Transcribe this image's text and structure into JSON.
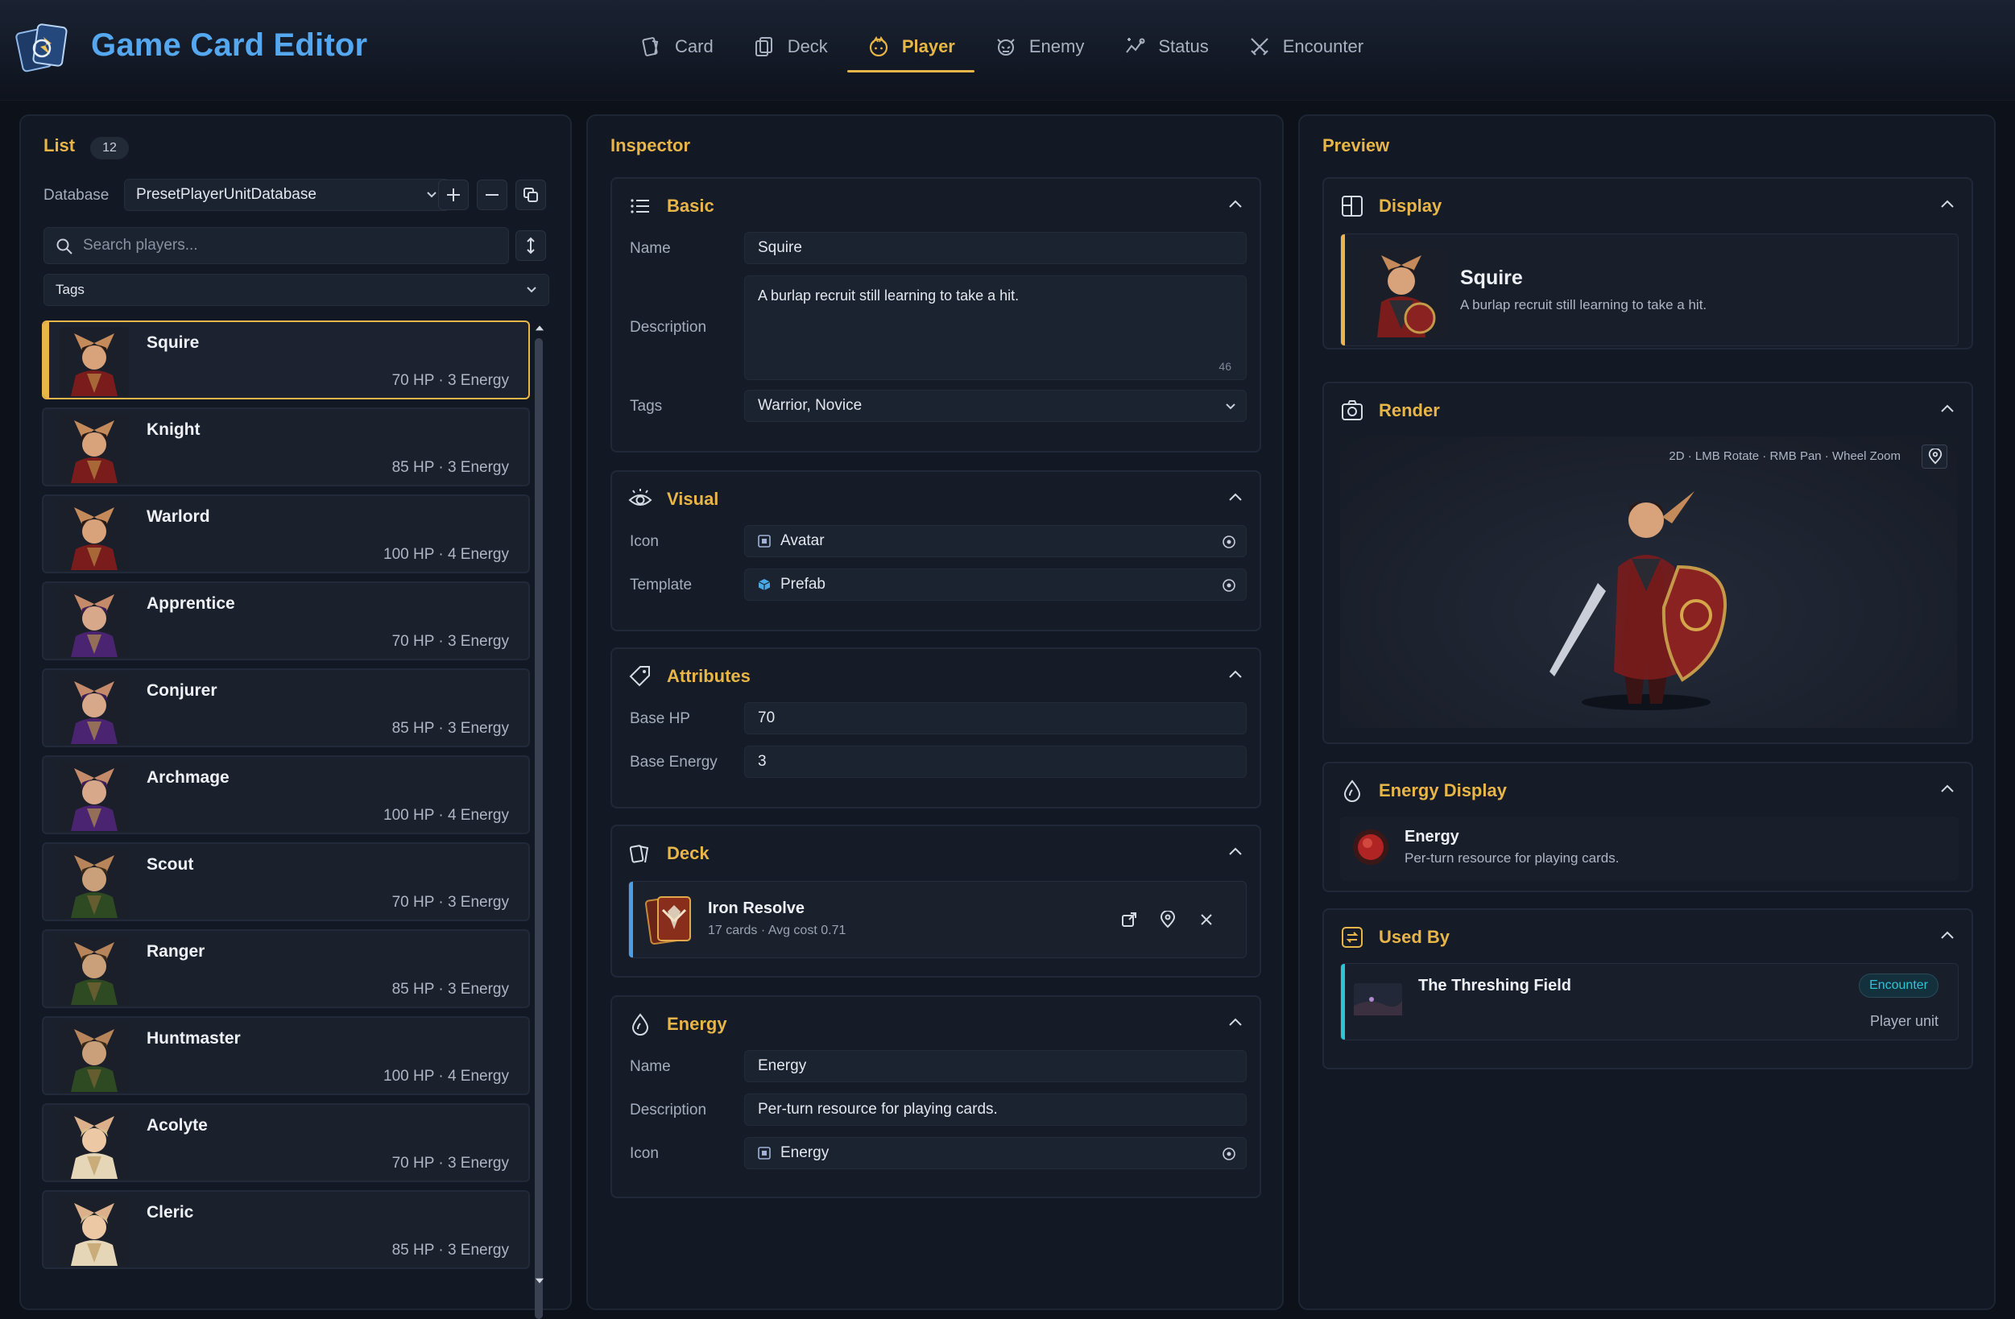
{
  "app": {
    "title": "Game Card Editor"
  },
  "nav": {
    "tabs": [
      {
        "label": "Card",
        "icon": "card-icon",
        "active": false
      },
      {
        "label": "Deck",
        "icon": "deck-icon",
        "active": false
      },
      {
        "label": "Player",
        "icon": "player-icon",
        "active": true
      },
      {
        "label": "Enemy",
        "icon": "enemy-icon",
        "active": false
      },
      {
        "label": "Status",
        "icon": "status-icon",
        "active": false
      },
      {
        "label": "Encounter",
        "icon": "encounter-icon",
        "active": false
      }
    ]
  },
  "list": {
    "title": "List",
    "count": "12",
    "database_label": "Database",
    "database_value": "PresetPlayerUnitDatabase",
    "search_placeholder": "Search players...",
    "tags_label": "Tags",
    "players": [
      {
        "name": "Squire",
        "stats": "70 HP · 3 Energy",
        "selected": true,
        "theme": "warrior"
      },
      {
        "name": "Knight",
        "stats": "85 HP · 3 Energy",
        "selected": false,
        "theme": "warrior"
      },
      {
        "name": "Warlord",
        "stats": "100 HP · 4 Energy",
        "selected": false,
        "theme": "warrior"
      },
      {
        "name": "Apprentice",
        "stats": "70 HP · 3 Energy",
        "selected": false,
        "theme": "mage"
      },
      {
        "name": "Conjurer",
        "stats": "85 HP · 3 Energy",
        "selected": false,
        "theme": "mage"
      },
      {
        "name": "Archmage",
        "stats": "100 HP · 4 Energy",
        "selected": false,
        "theme": "mage"
      },
      {
        "name": "Scout",
        "stats": "70 HP · 3 Energy",
        "selected": false,
        "theme": "ranger"
      },
      {
        "name": "Ranger",
        "stats": "85 HP · 3 Energy",
        "selected": false,
        "theme": "ranger"
      },
      {
        "name": "Huntmaster",
        "stats": "100 HP · 4 Energy",
        "selected": false,
        "theme": "ranger"
      },
      {
        "name": "Acolyte",
        "stats": "70 HP · 3 Energy",
        "selected": false,
        "theme": "cleric"
      },
      {
        "name": "Cleric",
        "stats": "85 HP · 3 Energy",
        "selected": false,
        "theme": "cleric"
      }
    ]
  },
  "inspector": {
    "title": "Inspector",
    "basic": {
      "title": "Basic",
      "name_label": "Name",
      "name_value": "Squire",
      "description_label": "Description",
      "description_value": "A burlap recruit still learning to take a hit.",
      "char_count": "46",
      "tags_label": "Tags",
      "tags_value": "Warrior, Novice"
    },
    "visual": {
      "title": "Visual",
      "icon_label": "Icon",
      "icon_value": "Avatar",
      "template_label": "Template",
      "template_value": "Prefab"
    },
    "attributes": {
      "title": "Attributes",
      "hp_label": "Base HP",
      "hp_value": "70",
      "energy_label": "Base Energy",
      "energy_value": "3"
    },
    "deck": {
      "title": "Deck",
      "name": "Iron Resolve",
      "meta": "17 cards · Avg cost 0.71"
    },
    "energy": {
      "title": "Energy",
      "name_label": "Name",
      "name_value": "Energy",
      "description_label": "Description",
      "description_value": "Per-turn resource for playing cards.",
      "icon_label": "Icon",
      "icon_value": "Energy"
    }
  },
  "preview": {
    "title": "Preview",
    "display": {
      "title": "Display",
      "name": "Squire",
      "description": "A burlap recruit still learning to take a hit."
    },
    "render": {
      "title": "Render",
      "hint": "2D · LMB Rotate · RMB Pan · Wheel Zoom"
    },
    "energy_display": {
      "title": "Energy Display",
      "name": "Energy",
      "description": "Per-turn resource for playing cards."
    },
    "used_by": {
      "title": "Used By",
      "name": "The Threshing Field",
      "badge": "Encounter",
      "role": "Player unit"
    }
  },
  "colors": {
    "accent": "#e8b548",
    "brand": "#55a8f0",
    "background": "#0d1119",
    "panel": "#121824",
    "badge": "#2ec4d6"
  }
}
